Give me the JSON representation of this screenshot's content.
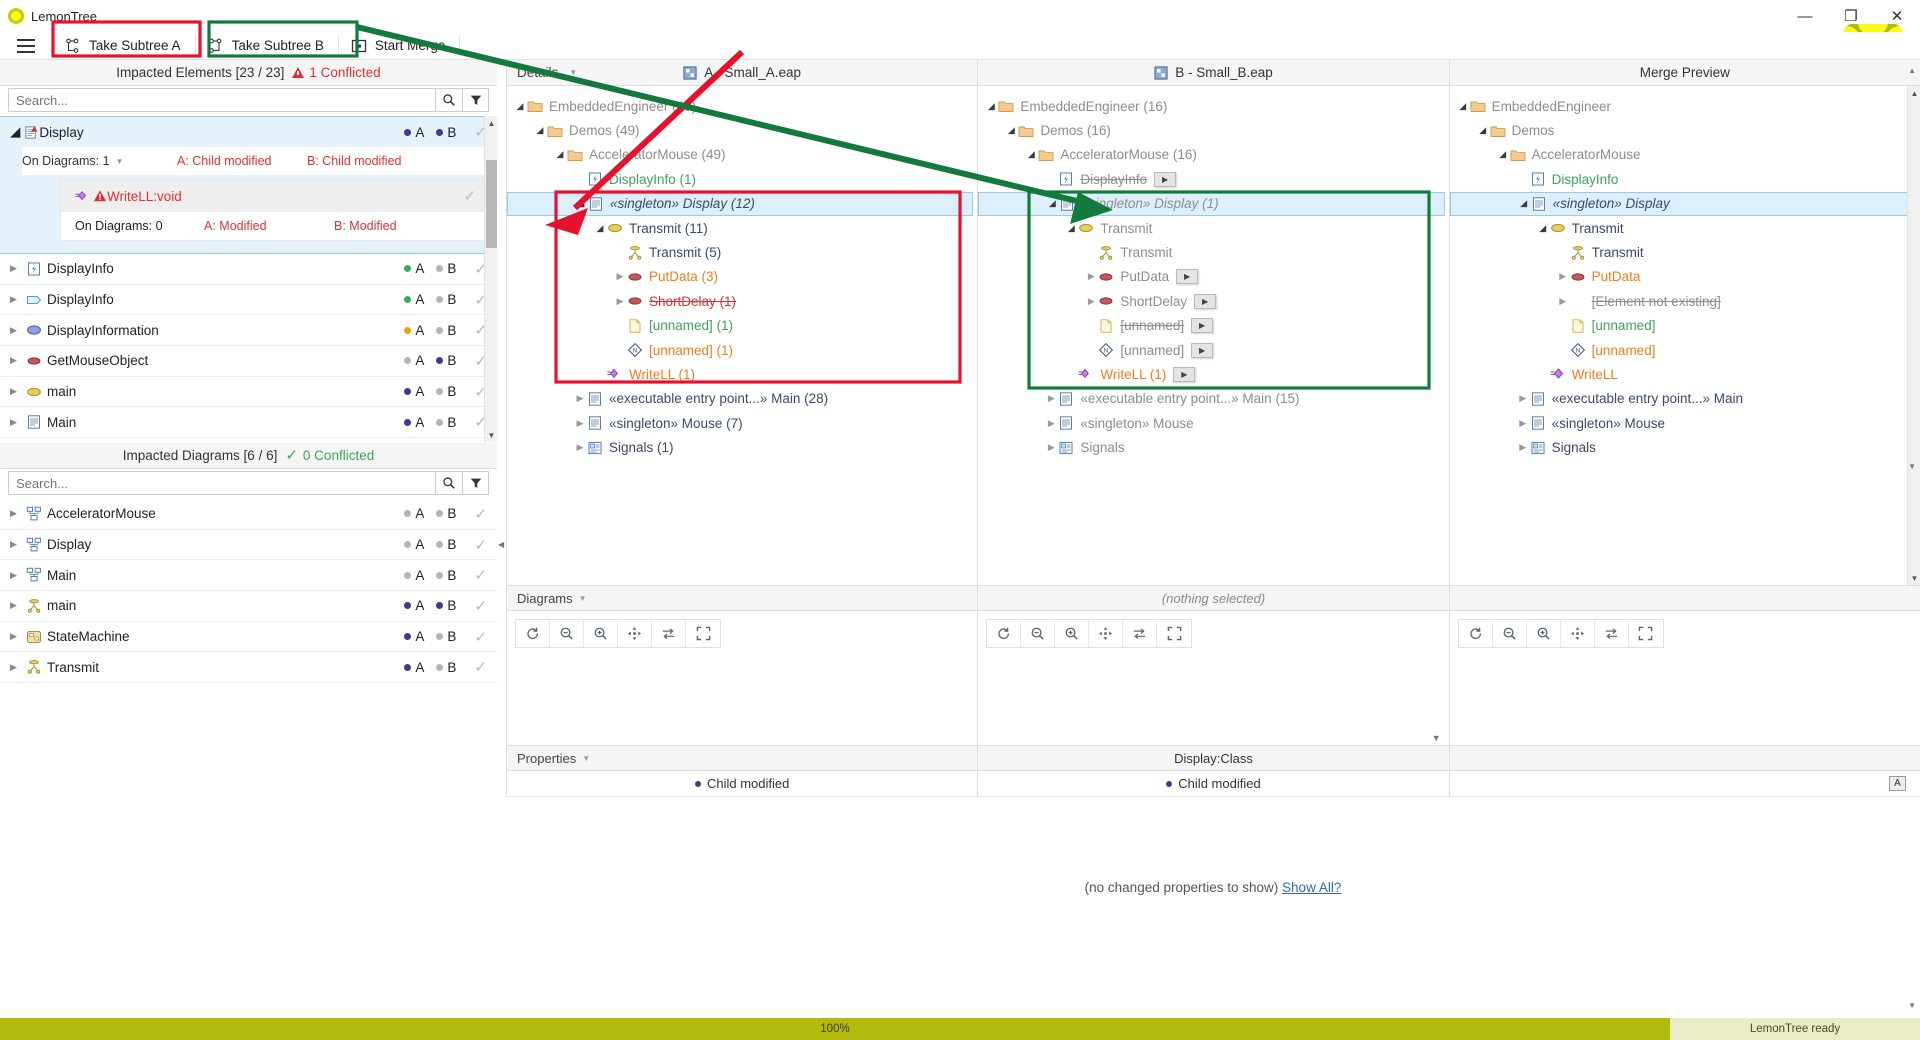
{
  "window": {
    "app_name": "LemonTree",
    "minimize": "—",
    "maximize": "❐",
    "close": "✕"
  },
  "toolbar": {
    "menu_label": "menu",
    "take_subtree_a": "Take Subtree A",
    "take_subtree_b": "Take Subtree B",
    "start_merge": "Start Merge"
  },
  "impacted_elements": {
    "header": "Impacted Elements [23 / 23]",
    "conflict_text": "1 Conflicted",
    "search_placeholder": "Search...",
    "selected": {
      "name": "Display",
      "icon": "class-warning-icon",
      "a_marker": "A",
      "b_marker": "B",
      "meta": {
        "on_diagrams": "On Diagrams: 1",
        "a_status": "A: Child modified",
        "b_status": "B: Child modified"
      },
      "child": {
        "name": "WriteLL:void",
        "on_diagrams": "On Diagrams: 0",
        "a_status": "A: Modified",
        "b_status": "B: Modified"
      }
    },
    "rows": [
      {
        "name": "DisplayInfo",
        "icon": "signal-icon",
        "a_dot": "#2eaf5f",
        "b_dot": "#b4b4b4",
        "a": "A",
        "b": "B",
        "check": "✓"
      },
      {
        "name": "DisplayInfo",
        "icon": "interface-icon",
        "a_dot": "#2eaf5f",
        "b_dot": "#b4b4b4",
        "a": "A",
        "b": "B",
        "check": "✓"
      },
      {
        "name": "DisplayInformation",
        "icon": "ellipse-blue-icon",
        "a_dot": "#f59a0b",
        "b_dot": "#b4b4b4",
        "a": "A",
        "b": "B",
        "check": "✓"
      },
      {
        "name": "GetMouseObject",
        "icon": "ellipse-red-icon",
        "a_dot": "#b4b4b4",
        "b_dot": "#3b3b8f",
        "a": "A",
        "b": "B",
        "check": "✓"
      },
      {
        "name": "main",
        "icon": "ellipse-yellow-icon",
        "a_dot": "#3b3b8f",
        "b_dot": "#b4b4b4",
        "a": "A",
        "b": "B",
        "check": "✓"
      },
      {
        "name": "Main",
        "icon": "class-icon",
        "a_dot": "#3b3b8f",
        "b_dot": "#b4b4b4",
        "a": "A",
        "b": "B",
        "check": "✓"
      }
    ]
  },
  "impacted_diagrams": {
    "header": "Impacted Diagrams [6 / 6]",
    "conflict_text": "0 Conflicted",
    "search_placeholder": "Search...",
    "rows": [
      {
        "name": "AcceleratorMouse",
        "icon": "diagram-icon",
        "a_dot": "#b4b4b4",
        "b_dot": "#b4b4b4",
        "a": "A",
        "b": "B",
        "check": "✓"
      },
      {
        "name": "Display",
        "icon": "diagram-icon",
        "a_dot": "#b4b4b4",
        "b_dot": "#b4b4b4",
        "a": "A",
        "b": "B",
        "check": "✓"
      },
      {
        "name": "Main",
        "icon": "diagram-icon",
        "a_dot": "#b4b4b4",
        "b_dot": "#b4b4b4",
        "a": "A",
        "b": "B",
        "check": "✓"
      },
      {
        "name": "main",
        "icon": "activity-icon",
        "a_dot": "#3b3b8f",
        "b_dot": "#3b3b8f",
        "a": "A",
        "b": "B",
        "check": "✓"
      },
      {
        "name": "StateMachine",
        "icon": "statemachine-icon",
        "a_dot": "#3b3b8f",
        "b_dot": "#b4b4b4",
        "a": "A",
        "b": "B",
        "check": "✓"
      },
      {
        "name": "Transmit",
        "icon": "activity-icon",
        "a_dot": "#3b3b8f",
        "b_dot": "#b4b4b4",
        "a": "A",
        "b": "B",
        "check": "✓"
      }
    ]
  },
  "details_label": "Details",
  "trees": {
    "a": {
      "title": "A - Small_A.eap",
      "nodes": [
        {
          "indent": 0,
          "twisty": "open",
          "icon": "folder-icon",
          "label": "EmbeddedEngineer (49)",
          "style": "grey"
        },
        {
          "indent": 1,
          "twisty": "open",
          "icon": "folder-icon",
          "label": "Demos (49)",
          "style": "grey"
        },
        {
          "indent": 2,
          "twisty": "open",
          "icon": "folder-icon",
          "label": "AcceleratorMouse (49)",
          "style": "grey"
        },
        {
          "indent": 3,
          "twisty": "none",
          "icon": "signal-icon",
          "label": "DisplayInfo (1)",
          "style": "green"
        },
        {
          "indent": 3,
          "twisty": "open",
          "icon": "class-icon",
          "label": "«singleton» Display (12)",
          "style": "navy ital",
          "selected": true
        },
        {
          "indent": 4,
          "twisty": "open",
          "icon": "ellipse-yellow-icon",
          "label": "Transmit (11)",
          "style": "navy"
        },
        {
          "indent": 5,
          "twisty": "none",
          "icon": "activity-icon",
          "label": "Transmit (5)",
          "style": "navy"
        },
        {
          "indent": 5,
          "twisty": "closed",
          "icon": "ellipse-red-icon",
          "label": "PutData (3)",
          "style": "orange"
        },
        {
          "indent": 5,
          "twisty": "closed",
          "icon": "ellipse-red-icon",
          "label": "ShortDelay (1)",
          "style": "red strike"
        },
        {
          "indent": 5,
          "twisty": "none",
          "icon": "note-icon",
          "label": "[unnamed] (1)",
          "style": "green"
        },
        {
          "indent": 5,
          "twisty": "none",
          "icon": "diamond-icon",
          "label": "[unnamed] (1)",
          "style": "orange"
        },
        {
          "indent": 4,
          "twisty": "none",
          "icon": "attr-warning-icon",
          "label": "WriteLL (1)",
          "style": "orange"
        },
        {
          "indent": 3,
          "twisty": "closed",
          "icon": "class-icon",
          "label": "«executable entry point...» Main (28)",
          "style": "navy"
        },
        {
          "indent": 3,
          "twisty": "closed",
          "icon": "class-icon",
          "label": "«singleton» Mouse (7)",
          "style": "navy"
        },
        {
          "indent": 3,
          "twisty": "closed",
          "icon": "signals-icon",
          "label": "Signals (1)",
          "style": "navy"
        }
      ]
    },
    "b": {
      "title": "B - Small_B.eap",
      "nodes": [
        {
          "indent": 0,
          "twisty": "open",
          "icon": "folder-icon",
          "label": "EmbeddedEngineer (16)",
          "style": "grey"
        },
        {
          "indent": 1,
          "twisty": "open",
          "icon": "folder-icon",
          "label": "Demos (16)",
          "style": "grey"
        },
        {
          "indent": 2,
          "twisty": "open",
          "icon": "folder-icon",
          "label": "AcceleratorMouse (16)",
          "style": "grey"
        },
        {
          "indent": 3,
          "twisty": "none",
          "icon": "signal-icon",
          "label": "DisplayInfo",
          "style": "grey strike",
          "play": true
        },
        {
          "indent": 3,
          "twisty": "open",
          "icon": "class-icon",
          "label": "«singleton» Display (1)",
          "style": "grey ital",
          "selected": true
        },
        {
          "indent": 4,
          "twisty": "open",
          "icon": "ellipse-yellow-icon",
          "label": "Transmit",
          "style": "grey"
        },
        {
          "indent": 5,
          "twisty": "none",
          "icon": "activity-icon",
          "label": "Transmit",
          "style": "grey"
        },
        {
          "indent": 5,
          "twisty": "closed",
          "icon": "ellipse-red-icon",
          "label": "PutData",
          "style": "grey",
          "play": true
        },
        {
          "indent": 5,
          "twisty": "closed",
          "icon": "ellipse-red-icon",
          "label": "ShortDelay",
          "style": "grey",
          "play": true
        },
        {
          "indent": 5,
          "twisty": "none",
          "icon": "note-icon",
          "label": "[unnamed]",
          "style": "grey strike",
          "play": true
        },
        {
          "indent": 5,
          "twisty": "none",
          "icon": "diamond-icon",
          "label": "[unnamed]",
          "style": "grey",
          "play": true
        },
        {
          "indent": 4,
          "twisty": "none",
          "icon": "attr-warning-icon",
          "label": "WriteLL (1)",
          "style": "orange",
          "play": true
        },
        {
          "indent": 3,
          "twisty": "closed",
          "icon": "class-icon",
          "label": "«executable entry point...» Main (15)",
          "style": "grey"
        },
        {
          "indent": 3,
          "twisty": "closed",
          "icon": "class-icon",
          "label": "«singleton» Mouse",
          "style": "grey"
        },
        {
          "indent": 3,
          "twisty": "closed",
          "icon": "signals-icon",
          "label": "Signals",
          "style": "grey"
        }
      ]
    },
    "merge": {
      "title": "Merge Preview",
      "nodes": [
        {
          "indent": 0,
          "twisty": "open",
          "icon": "folder-icon",
          "label": "EmbeddedEngineer",
          "style": "grey"
        },
        {
          "indent": 1,
          "twisty": "open",
          "icon": "folder-icon",
          "label": "Demos",
          "style": "grey"
        },
        {
          "indent": 2,
          "twisty": "open",
          "icon": "folder-icon",
          "label": "AcceleratorMouse",
          "style": "grey"
        },
        {
          "indent": 3,
          "twisty": "none",
          "icon": "signal-icon",
          "label": "DisplayInfo",
          "style": "green"
        },
        {
          "indent": 3,
          "twisty": "open",
          "icon": "class-icon",
          "label": "«singleton» Display",
          "style": "navy ital",
          "selected": true
        },
        {
          "indent": 4,
          "twisty": "open",
          "icon": "ellipse-yellow-icon",
          "label": "Transmit",
          "style": "navy"
        },
        {
          "indent": 5,
          "twisty": "none",
          "icon": "activity-icon",
          "label": "Transmit",
          "style": "navy"
        },
        {
          "indent": 5,
          "twisty": "closed",
          "icon": "ellipse-red-icon",
          "label": "PutData",
          "style": "orange"
        },
        {
          "indent": 5,
          "twisty": "closed",
          "icon": "none-icon",
          "label": "[Element not existing]",
          "style": "grey strike"
        },
        {
          "indent": 5,
          "twisty": "none",
          "icon": "note-icon",
          "label": "[unnamed]",
          "style": "green"
        },
        {
          "indent": 5,
          "twisty": "none",
          "icon": "diamond-icon",
          "label": "[unnamed]",
          "style": "orange"
        },
        {
          "indent": 4,
          "twisty": "none",
          "icon": "attr-icon",
          "label": "WriteLL",
          "style": "orange"
        },
        {
          "indent": 3,
          "twisty": "closed",
          "icon": "class-icon",
          "label": "«executable entry point...» Main",
          "style": "navy"
        },
        {
          "indent": 3,
          "twisty": "closed",
          "icon": "class-icon",
          "label": "«singleton» Mouse",
          "style": "navy"
        },
        {
          "indent": 3,
          "twisty": "closed",
          "icon": "signals-icon",
          "label": "Signals",
          "style": "navy"
        }
      ]
    }
  },
  "diagrams_pane": {
    "label": "Diagrams",
    "nothing_selected": "(nothing selected)",
    "buttons": [
      "refresh-icon",
      "zoom-out-icon",
      "zoom-in-icon",
      "fit-icon",
      "sync-icon",
      "fullscreen-icon"
    ]
  },
  "properties_pane": {
    "label": "Properties",
    "title": "Display:Class",
    "a_status": "Child modified",
    "b_status": "Child modified",
    "badge": "A",
    "empty_text": "(no changed properties to show)",
    "show_all_link": "Show All?"
  },
  "statusbar": {
    "progress": "100%",
    "ready": "LemonTree ready"
  },
  "annotations": {
    "red_boxes": [
      "take-subtree-a-button",
      "tree-a-display-subtree"
    ],
    "green_boxes": [
      "take-subtree-b-button",
      "tree-b-display-subtree"
    ]
  }
}
